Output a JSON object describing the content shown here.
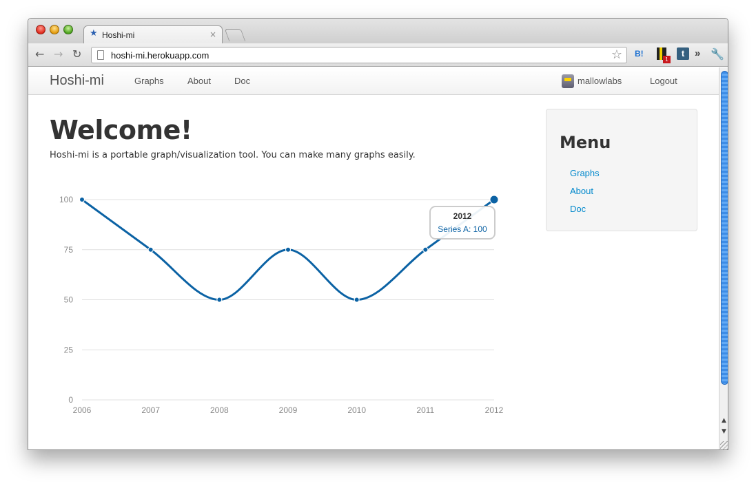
{
  "browser": {
    "tab_title": "Hoshi-mi",
    "tab_close": "×",
    "url": "hoshi-mi.herokuapp.com",
    "back": "←",
    "forward": "→",
    "reload": "↻",
    "star": "☆",
    "ext_hatena": "B!",
    "ext_badge": "1",
    "ext_tumblr": "t",
    "ext_more": "»",
    "wrench": "🔧"
  },
  "navbar": {
    "brand": "Hoshi-mi",
    "links": [
      "Graphs",
      "About",
      "Doc"
    ],
    "user": "mallowlabs",
    "logout": "Logout"
  },
  "main": {
    "title": "Welcome!",
    "intro": "Hoshi-mi is a portable graph/visualization tool. You can make many graphs easily."
  },
  "menu": {
    "title": "Menu",
    "links": [
      "Graphs",
      "About",
      "Doc"
    ]
  },
  "colors": {
    "series": "#0b62a4",
    "grid": "#e0e0e0",
    "link": "#0088cc"
  },
  "chart_data": {
    "type": "line",
    "x": [
      "2006",
      "2007",
      "2008",
      "2009",
      "2010",
      "2011",
      "2012"
    ],
    "series": [
      {
        "name": "Series A",
        "values": [
          100,
          75,
          50,
          75,
          50,
          75,
          100
        ]
      }
    ],
    "yticks": [
      "0",
      "25",
      "50",
      "75",
      "100"
    ],
    "ylim": [
      0,
      100
    ],
    "grid": true,
    "smooth": true,
    "tooltip": {
      "title": "2012",
      "text": "Series A: 100"
    }
  }
}
